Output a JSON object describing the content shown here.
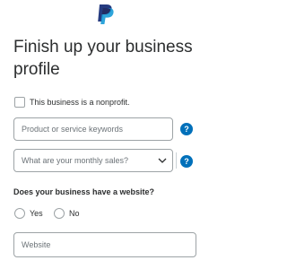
{
  "header": {
    "logo": "paypal-logo",
    "title": "Finish up your business profile"
  },
  "form": {
    "nonprofit_label": "This business is a nonprofit.",
    "keywords_placeholder": "Product or service keywords",
    "keywords_value": "",
    "sales_placeholder": "What are your monthly sales?",
    "help_glyph": "?",
    "website_question": "Does your business have a website?",
    "radio_yes": "Yes",
    "radio_no": "No",
    "website_placeholder": "Website",
    "website_value": ""
  },
  "colors": {
    "accent": "#0070ba",
    "logo_dark": "#253b80",
    "logo_light": "#179bd7",
    "border": "#9da3a6"
  }
}
